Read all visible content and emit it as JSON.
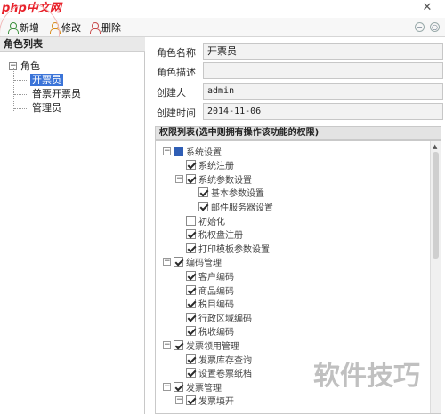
{
  "logo": {
    "php": "php",
    "cn": "中文网"
  },
  "window": {
    "close_glyph": "✕"
  },
  "toolbar": {
    "new_label": "新增",
    "edit_label": "修改",
    "delete_label": "删除"
  },
  "left": {
    "header": "角色列表",
    "root": "角色",
    "children": [
      "开票员",
      "普票开票员",
      "管理员"
    ]
  },
  "form": {
    "role_name_label": "角色名称",
    "role_name_value": "开票员",
    "role_desc_label": "角色描述",
    "role_desc_value": "",
    "creator_label": "创建人",
    "creator_value": "admin",
    "created_time_label": "创建时间",
    "created_time_value": "2014-11-06"
  },
  "permissions": {
    "header": "权限列表(选中则拥有操作该功能的权限)",
    "items": [
      {
        "label": "系统设置",
        "level": 0,
        "state": "partial",
        "expand": true
      },
      {
        "label": "系统注册",
        "level": 1,
        "state": "on"
      },
      {
        "label": "系统参数设置",
        "level": 1,
        "state": "on",
        "expand": true
      },
      {
        "label": "基本参数设置",
        "level": 2,
        "state": "on"
      },
      {
        "label": "邮件服务器设置",
        "level": 2,
        "state": "on"
      },
      {
        "label": "初始化",
        "level": 1,
        "state": "off"
      },
      {
        "label": "税权盘注册",
        "level": 1,
        "state": "on"
      },
      {
        "label": "打印模板参数设置",
        "level": 1,
        "state": "on"
      },
      {
        "label": "编码管理",
        "level": 0,
        "state": "on",
        "expand": true
      },
      {
        "label": "客户编码",
        "level": 1,
        "state": "on"
      },
      {
        "label": "商品编码",
        "level": 1,
        "state": "on"
      },
      {
        "label": "税目编码",
        "level": 1,
        "state": "on"
      },
      {
        "label": "行政区域编码",
        "level": 1,
        "state": "on"
      },
      {
        "label": "税收编码",
        "level": 1,
        "state": "on"
      },
      {
        "label": "发票领用管理",
        "level": 0,
        "state": "on",
        "expand": true
      },
      {
        "label": "发票库存查询",
        "level": 1,
        "state": "on"
      },
      {
        "label": "设置卷票纸档",
        "level": 1,
        "state": "on"
      },
      {
        "label": "发票管理",
        "level": 0,
        "state": "on",
        "expand": true
      },
      {
        "label": "发票填开",
        "level": 1,
        "state": "on",
        "expand": true
      }
    ]
  },
  "watermark": {
    "text": "软件技巧"
  }
}
